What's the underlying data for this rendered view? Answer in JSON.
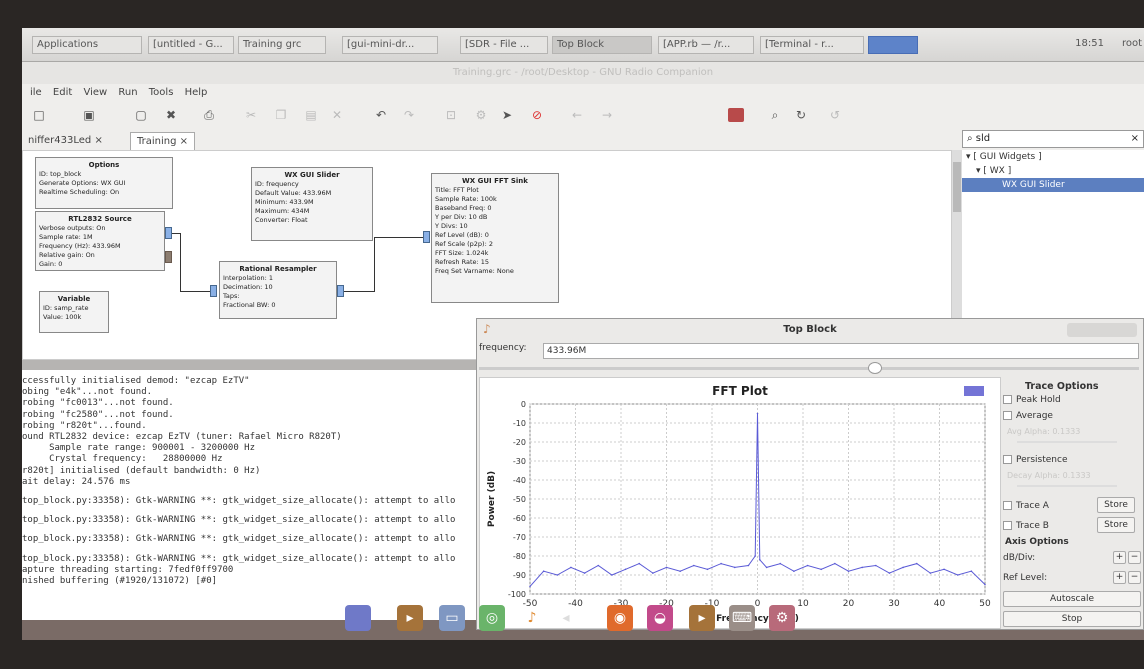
{
  "taskbar": {
    "tasks": [
      "Applications",
      "[untitled - G...",
      "Training grc",
      "[gui-mini-dr...",
      "[SDR - File ...",
      "Top Block",
      "[APP.rb — /r...",
      "[Terminal - r..."
    ],
    "clock": "18:51",
    "user": "root"
  },
  "window_title": "Training.grc - /root/Desktop - GNU Radio Companion",
  "menu": [
    "ile",
    "Edit",
    "View",
    "Run",
    "Tools",
    "Help"
  ],
  "tabs": [
    "niffer433Led",
    "Training"
  ],
  "search": {
    "value": "sld"
  },
  "tree": [
    "[ GUI Widgets ]",
    "[ WX ]",
    "WX GUI Slider"
  ],
  "blocks": {
    "options": {
      "title": "Options",
      "lines": [
        "ID: top_block",
        "Generate Options: WX GUI",
        "Realtime Scheduling: On"
      ]
    },
    "rtl": {
      "title": "RTL2832 Source",
      "lines": [
        "Verbose outputs: On",
        "Sample rate: 1M",
        "Frequency (Hz): 433.96M",
        "Relative gain: On",
        "Gain: 0"
      ]
    },
    "variable": {
      "title": "Variable",
      "lines": [
        "ID: samp_rate",
        "Value: 100k"
      ]
    },
    "slider": {
      "title": "WX GUI Slider",
      "lines": [
        "ID: frequency",
        "Default Value: 433.96M",
        "Minimum: 433.9M",
        "Maximum: 434M",
        "Converter: Float"
      ]
    },
    "resampler": {
      "title": "Rational Resampler",
      "lines": [
        "Interpolation: 1",
        "Decimation: 10",
        "Taps:",
        "Fractional BW: 0"
      ]
    },
    "fft": {
      "title": "WX GUI FFT Sink",
      "lines": [
        "Title: FFT Plot",
        "Sample Rate: 100k",
        "Baseband Freq: 0",
        "Y per Div: 10 dB",
        "Y Divs: 10",
        "Ref Level (dB): 0",
        "Ref Scale (p2p): 2",
        "FFT Size: 1.024k",
        "Refresh Rate: 15",
        "Freq Set Varname: None"
      ]
    }
  },
  "console": [
    "ccessfully initialised demod: \"ezcap EzTV\"",
    "obing \"e4k\"...not found.",
    "robing \"fc0013\"...not found.",
    "robing \"fc2580\"...not found.",
    "robing \"r820t\"...found.",
    "ound RTL2832 device: ezcap EzTV (tuner: Rafael Micro R820T)",
    "     Sample rate range: 900001 - 3200000 Hz",
    "     Crystal frequency:   28800000 Hz",
    "r820t] initialised (default bandwidth: 0 Hz)",
    "ait delay: 24.576 ms",
    "",
    "top_block.py:33358): Gtk-WARNING **: gtk_widget_size_allocate(): attempt to allo",
    "",
    "top_block.py:33358): Gtk-WARNING **: gtk_widget_size_allocate(): attempt to allo",
    "",
    "top_block.py:33358): Gtk-WARNING **: gtk_widget_size_allocate(): attempt to allo",
    "",
    "top_block.py:33358): Gtk-WARNING **: gtk_widget_size_allocate(): attempt to allo",
    "apture threading starting: 7fedf0ff9700",
    "nished buffering (#1920/131072) [#0]"
  ],
  "topblock": {
    "title": "Top Block",
    "freq_label": "frequency:",
    "freq_value": "433.96M",
    "slider_fraction": 0.6,
    "trace": {
      "header": "Trace Options",
      "peak_hold": "Peak Hold",
      "average": "Average",
      "avg_alpha": "Avg Alpha: 0.1333",
      "persistence": "Persistence",
      "decay": "Decay Alpha: 0.1333",
      "trace_a": "Trace A",
      "trace_b": "Trace B",
      "store": "Store",
      "axis_header": "Axis Options",
      "db_div": "dB/Div:",
      "ref_level": "Ref Level:",
      "autoscale": "Autoscale",
      "stop": "Stop"
    }
  },
  "chart_data": {
    "type": "line",
    "title": "FFT Plot",
    "xlabel": "Frequency (kHz)",
    "ylabel": "Power (dB)",
    "xlim": [
      -50,
      50
    ],
    "ylim": [
      -100,
      0
    ],
    "xticks": [
      -50,
      -40,
      -30,
      -20,
      -10,
      0,
      10,
      20,
      30,
      40,
      50
    ],
    "yticks": [
      0,
      -10,
      -20,
      -30,
      -40,
      -50,
      -60,
      -70,
      -80,
      -90,
      -100
    ],
    "grid": true,
    "color": "#5a5ad6",
    "series": [
      {
        "x": [
          -50,
          -47,
          -44,
          -41,
          -38,
          -35,
          -32,
          -29,
          -26,
          -23,
          -20,
          -17,
          -14,
          -11,
          -8,
          -5,
          -2,
          -0.5,
          0,
          0.5,
          2,
          5,
          8,
          11,
          14,
          17,
          20,
          23,
          26,
          29,
          32,
          35,
          38,
          41,
          44,
          47,
          50
        ],
        "y": [
          -96,
          -88,
          -90,
          -86,
          -89,
          -85,
          -90,
          -87,
          -84,
          -89,
          -86,
          -88,
          -85,
          -87,
          -84,
          -86,
          -85,
          -80,
          -5,
          -82,
          -86,
          -84,
          -88,
          -85,
          -87,
          -84,
          -88,
          -86,
          -85,
          -89,
          -86,
          -84,
          -89,
          -87,
          -90,
          -88,
          -95
        ]
      }
    ]
  }
}
